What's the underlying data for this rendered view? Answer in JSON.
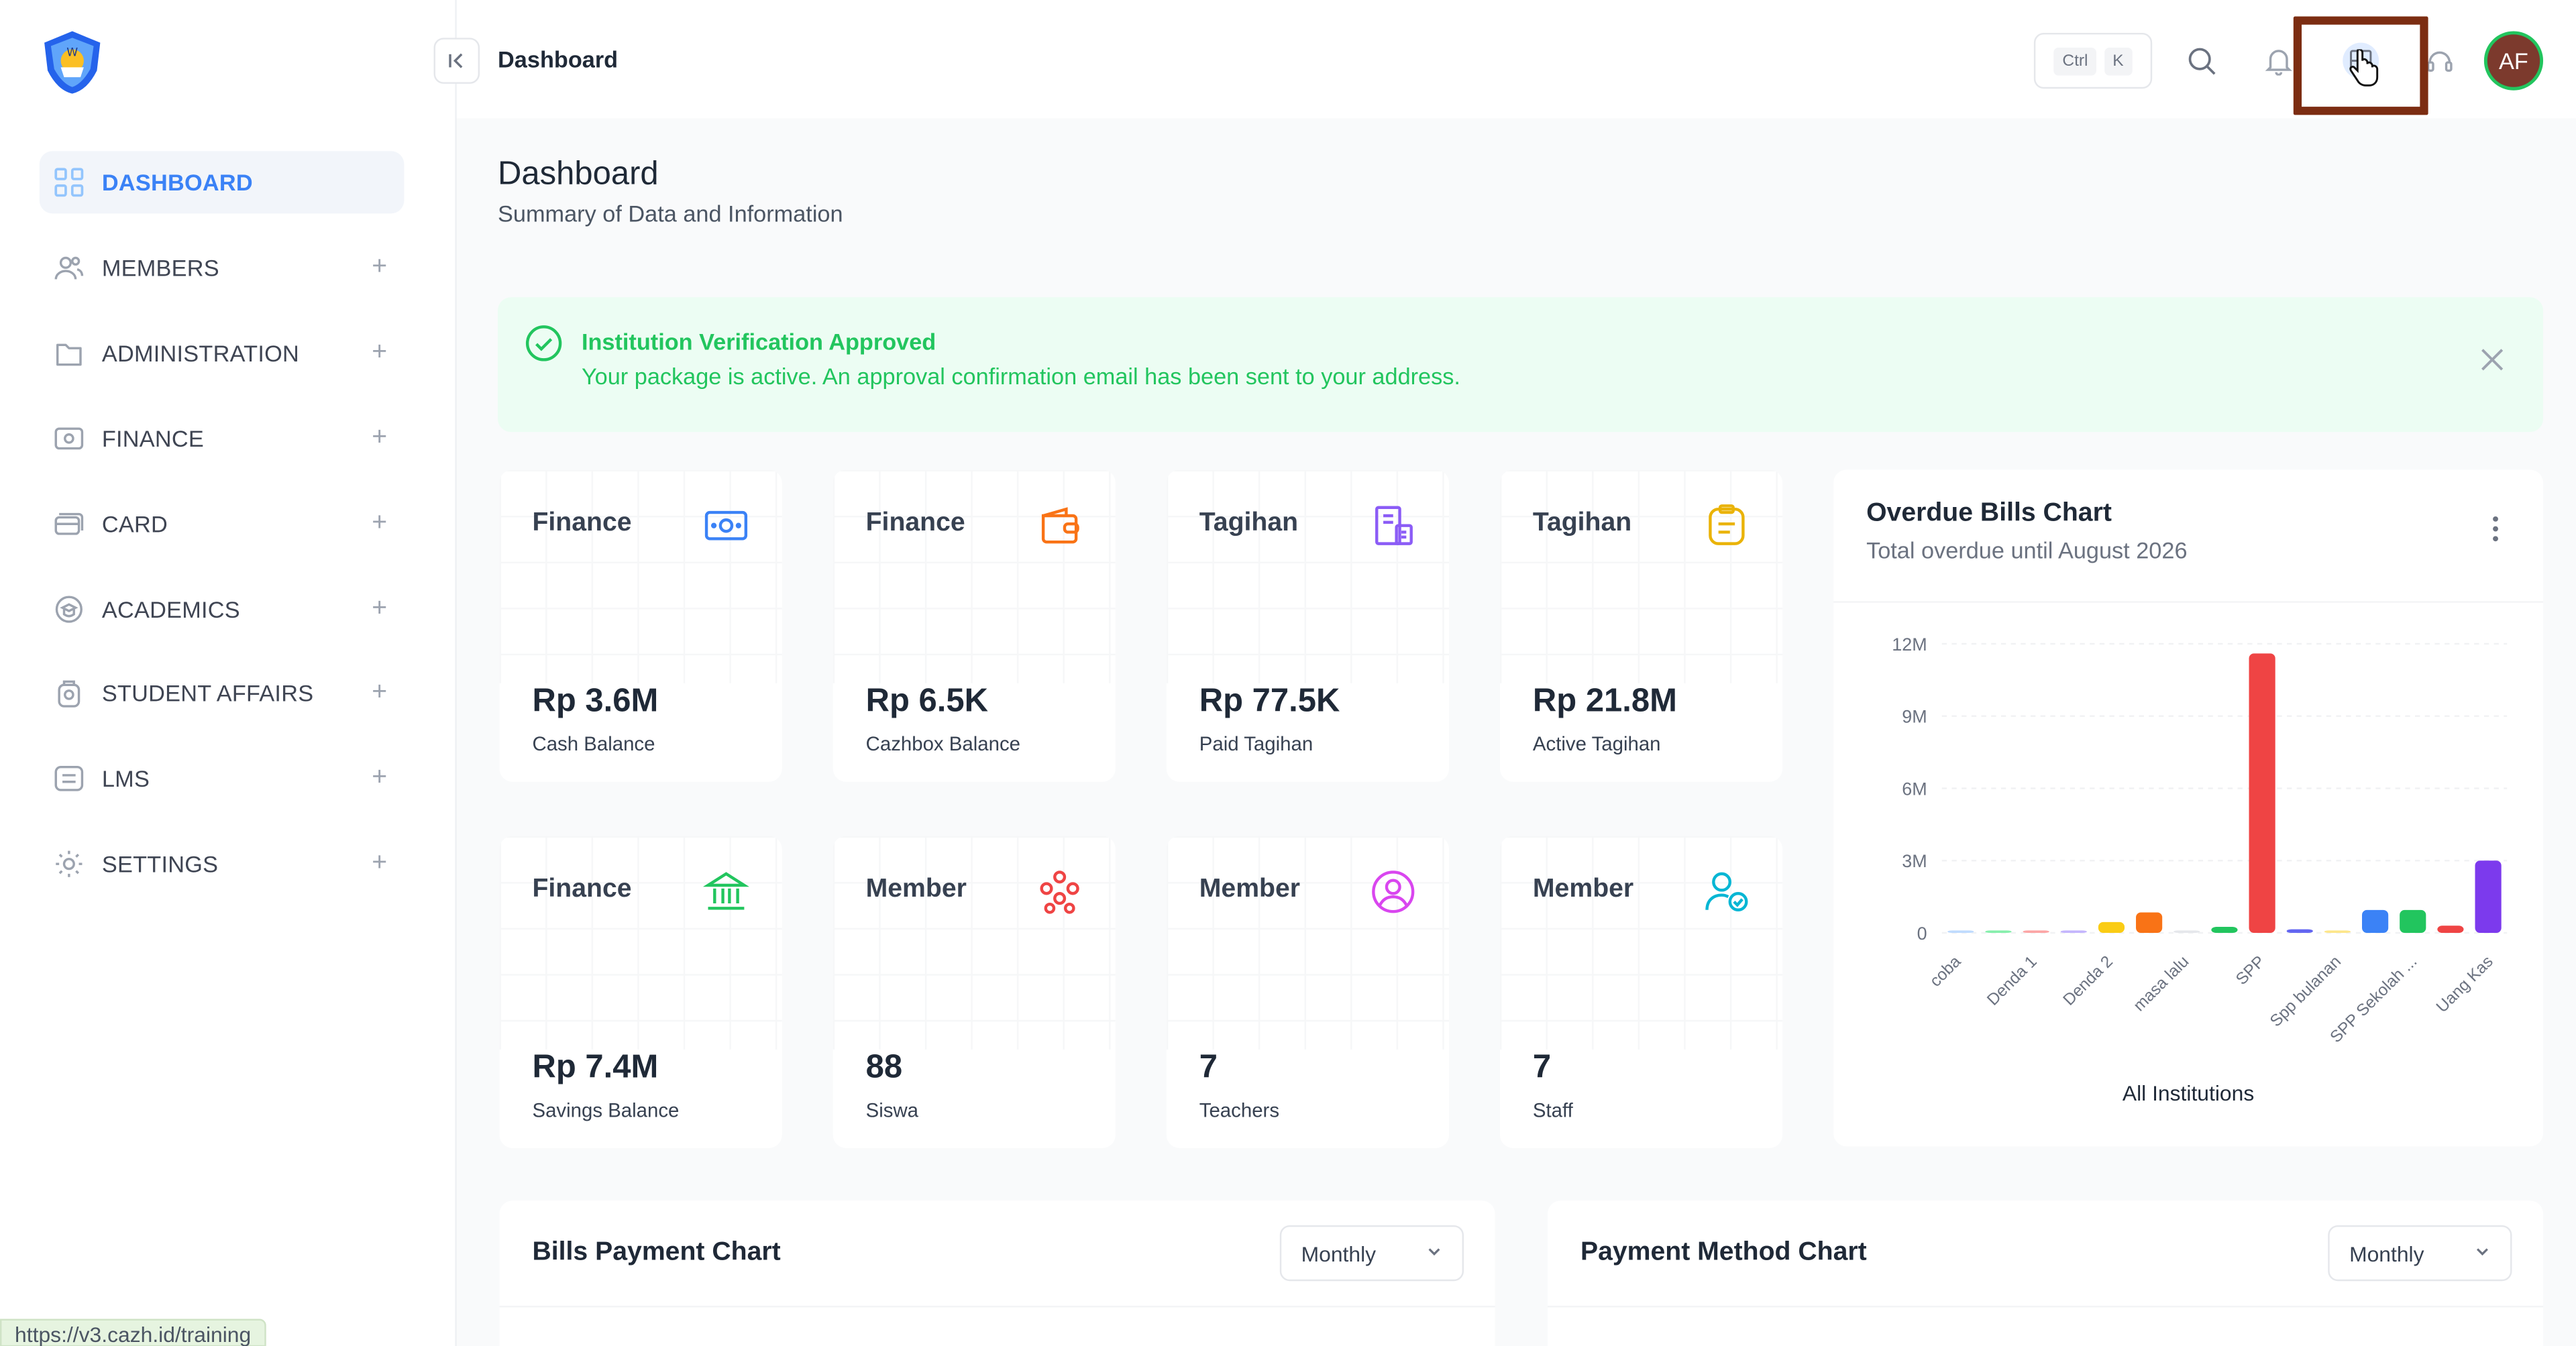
{
  "sidebar": {
    "items": [
      {
        "label": "DASHBOARD",
        "icon": "grid-icon",
        "active": true
      },
      {
        "label": "MEMBERS",
        "icon": "users-icon"
      },
      {
        "label": "ADMINISTRATION",
        "icon": "folder-icon"
      },
      {
        "label": "FINANCE",
        "icon": "cash-icon"
      },
      {
        "label": "CARD",
        "icon": "card-icon"
      },
      {
        "label": "ACADEMICS",
        "icon": "academic-icon"
      },
      {
        "label": "STUDENT AFFAIRS",
        "icon": "student-icon"
      },
      {
        "label": "LMS",
        "icon": "lms-icon"
      },
      {
        "label": "SETTINGS",
        "icon": "gear-icon"
      }
    ]
  },
  "topbar": {
    "breadcrumb": "Dashboard",
    "kbd1": "Ctrl",
    "kbd2": "K",
    "avatar_initials": "AF"
  },
  "header": {
    "title": "Dashboard",
    "subtitle": "Summary of Data and Information"
  },
  "alert": {
    "title": "Institution Verification Approved",
    "message": "Your package is active. An approval confirmation email has been sent to your address."
  },
  "cards": [
    {
      "title": "Finance",
      "value": "Rp 3.6M",
      "label": "Cash Balance",
      "icon": "money-icon",
      "color": "#3b82f6"
    },
    {
      "title": "Finance",
      "value": "Rp 6.5K",
      "label": "Cazhbox Balance",
      "icon": "wallet-icon",
      "color": "#f97316"
    },
    {
      "title": "Tagihan",
      "value": "Rp 77.5K",
      "label": "Paid Tagihan",
      "icon": "bill-icon",
      "color": "#8b5cf6"
    },
    {
      "title": "Tagihan",
      "value": "Rp 21.8M",
      "label": "Active Tagihan",
      "icon": "clipboard-icon",
      "color": "#eab308"
    },
    {
      "title": "Finance",
      "value": "Rp 7.4M",
      "label": "Savings Balance",
      "icon": "bank-icon",
      "color": "#22c55e"
    },
    {
      "title": "Member",
      "value": "88",
      "label": "Siswa",
      "icon": "group-icon",
      "color": "#ef4444"
    },
    {
      "title": "Member",
      "value": "7",
      "label": "Teachers",
      "icon": "user-circle-icon",
      "color": "#d946ef"
    },
    {
      "title": "Member",
      "value": "7",
      "label": "Staff",
      "icon": "user-check-icon",
      "color": "#06b6d4"
    }
  ],
  "overdue": {
    "title": "Overdue Bills Chart",
    "subtitle": "Total overdue until August 2026",
    "footer": "All Institutions"
  },
  "chart_data": {
    "type": "bar",
    "ylim": [
      0,
      12000000
    ],
    "yticks": [
      "0",
      "3M",
      "6M",
      "9M",
      "12M"
    ],
    "xticks": [
      "coba",
      "Denda 1",
      "Denda 2",
      "masa lalu",
      "SPP",
      "Spp bulanan",
      "SPP Sekolah ...",
      "Uang Kas"
    ],
    "series": [
      {
        "values": [
          50000,
          60000,
          70000,
          80000,
          450000,
          850000,
          30000,
          250000,
          11600000,
          150000,
          80000,
          950000,
          950000,
          300000,
          3000000
        ],
        "colors": [
          "#bfdbfe",
          "#86efac",
          "#fca5a5",
          "#c4b5fd",
          "#facc15",
          "#f97316",
          "#e5e7eb",
          "#22c55e",
          "#ef4444",
          "#6366f1",
          "#fde68a",
          "#3b82f6",
          "#22c55e",
          "#ef4444",
          "#7c3aed"
        ]
      }
    ]
  },
  "bills_panel": {
    "title": "Bills Payment Chart",
    "select": "Monthly"
  },
  "method_panel": {
    "title": "Payment Method Chart",
    "select": "Monthly"
  },
  "status_url": "https://v3.cazh.id/training"
}
